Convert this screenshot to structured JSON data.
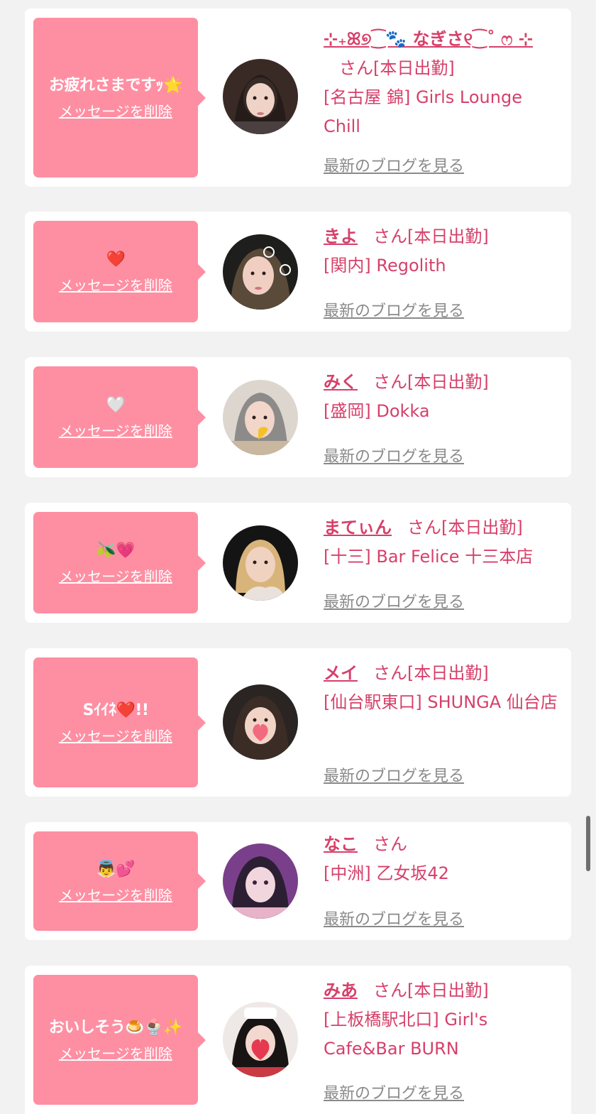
{
  "delete_label": "メッセージを削除",
  "blog_label": "最新のブログを見る",
  "san_suffix": "さん",
  "colors": {
    "bubble": "#fe8fa3",
    "accent": "#d6406a",
    "link_gray": "#8a8a8a",
    "card": "#ffffff",
    "page": "#f2f2f2"
  },
  "cards": [
    {
      "message": "お疲れさまですｯ🌟",
      "name": "⊹₊ꕤ୭⁐🐾 なぎさ୧⁐˚ ෆ ⊹",
      "status": "[本日出勤]",
      "shop": "[名古屋 錦] Girls Lounge Chill",
      "avatar_hint": "dark-hair-girl"
    },
    {
      "message": "❤️",
      "name": "きよ",
      "status": "[本日出勤]",
      "shop": "[関内] Regolith",
      "avatar_hint": "sticker-girl"
    },
    {
      "message": "🤍",
      "name": "みく",
      "status": "[本日出勤]",
      "shop": "[盛岡] Dokka",
      "avatar_hint": "gray-hair-girl"
    },
    {
      "message": "🫒💗",
      "name": "まてぃん",
      "status": "[本日出勤]",
      "shop": "[十三] Bar Felice 十三本店",
      "avatar_hint": "blonde-girl"
    },
    {
      "message": "Sｲｲﾈ❤️!!",
      "name": "メイ",
      "status": "[本日出勤]",
      "shop": "[仙台駅東口] SHUNGA 仙台店",
      "avatar_hint": "heart-face-girl"
    },
    {
      "message": "👼💕",
      "name": "なこ",
      "status": "",
      "shop": "[中洲] 乙女坂42",
      "avatar_hint": "purple-girl"
    },
    {
      "message": "おいしそう🍮🍨✨",
      "name": "みあ",
      "status": "[本日出勤]",
      "shop": "[上板橋駅北口] Girl's Cafe&Bar BURN",
      "avatar_hint": "nurse-girl"
    }
  ]
}
